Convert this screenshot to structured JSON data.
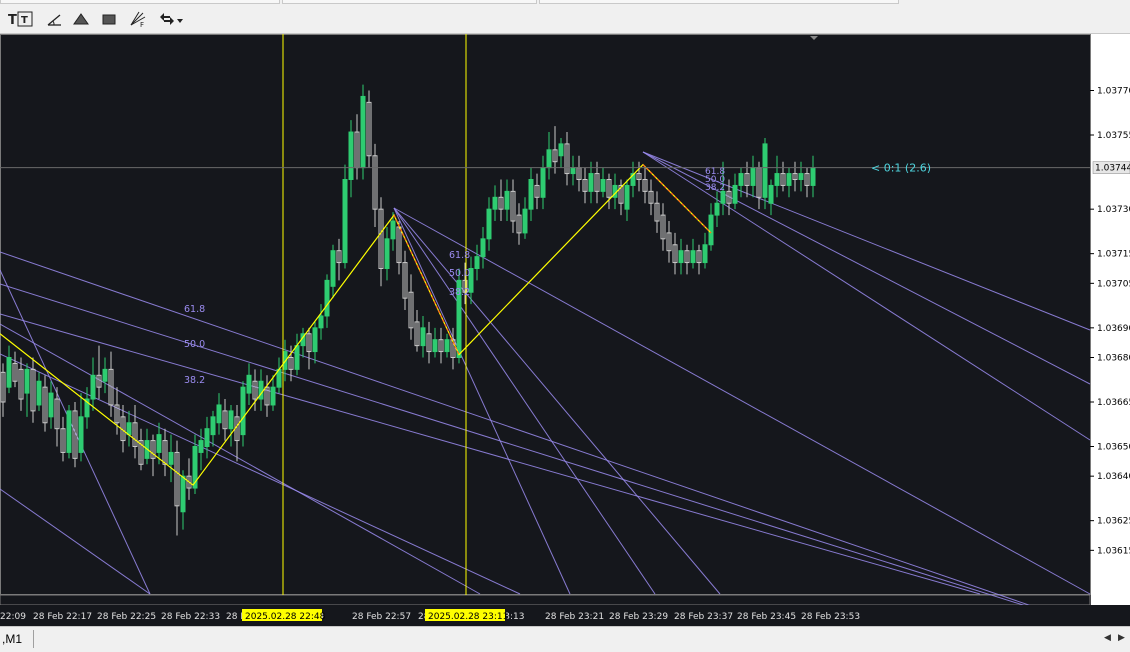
{
  "toolbar": {
    "tools": [
      {
        "icon": "text-label-icon",
        "glyph": "T"
      },
      {
        "icon": "text-frame-icon",
        "glyph": "T"
      },
      {
        "icon": "angle-draw-icon",
        "glyph": ""
      },
      {
        "icon": "triangle-icon",
        "glyph": ""
      },
      {
        "icon": "rectangle-icon",
        "glyph": ""
      },
      {
        "icon": "fibonacci-fan-icon",
        "glyph": "F"
      },
      {
        "icon": "arrows-menu-icon",
        "glyph": "▾"
      }
    ]
  },
  "colors": {
    "background": "#15171c",
    "grid_border": "#7a7a7a",
    "bull_candle": "#2ecc71",
    "bear_candle": "#c9c9c9",
    "zigzag": "#ffff00",
    "fan_lines": "#9b8cf0",
    "fan_labels": "#9b8cf0",
    "current_price_label": "#4fd6e0",
    "vertical_lines": "#ffff00",
    "date_badge_bg": "#ffff00"
  },
  "chart": {
    "price_levels": [
      "1.03770",
      "1.03755",
      "1.03730",
      "1.03715",
      "1.03705",
      "1.03690",
      "1.03680",
      "1.03665",
      "1.03650",
      "1.03640",
      "1.03625",
      "1.03615"
    ],
    "current_price": "1.03744",
    "fan_label_text": "< 0:1 (2.6)",
    "fan_level_labels": [
      "61.8",
      "50.0",
      "38.2"
    ],
    "time_labels": [
      "22:09",
      "28 Feb 22:17",
      "28 Feb 22:25",
      "28 Feb 22:33",
      "28 F",
      "22:49",
      "28 Feb 22:57",
      "28",
      "b 23:13",
      "28 Feb 23:21",
      "28 Feb 23:29",
      "28 Feb 23:37",
      "28 Feb 23:45",
      "28 Feb 23:53"
    ],
    "vline_badges": [
      "2025.02.28 22:48",
      "2025.02.28 23:11"
    ]
  },
  "chart_data": {
    "type": "candlestick",
    "title": "",
    "y_range": [
      1.03605,
      1.03785
    ],
    "current_price": 1.03744,
    "vertical_lines": [
      "2025.02.28 22:48",
      "2025.02.28 23:11"
    ],
    "zigzag_pivots": [
      {
        "x": 0,
        "y": 1.03688
      },
      {
        "x": 193,
        "y": 1.03637
      },
      {
        "x": 394,
        "y": 1.03728
      },
      {
        "x": 459,
        "y": 1.03681
      },
      {
        "x": 643,
        "y": 1.03745
      },
      {
        "x": 711,
        "y": 1.03722
      }
    ],
    "candles": [
      {
        "x": 3,
        "o": 1.03675,
        "c": 1.03665,
        "h": 1.03678,
        "l": 1.0366
      },
      {
        "x": 9,
        "o": 1.0367,
        "c": 1.0368,
        "h": 1.03684,
        "l": 1.03668
      },
      {
        "x": 15,
        "o": 1.03678,
        "c": 1.03672,
        "h": 1.03682,
        "l": 1.0367
      },
      {
        "x": 21,
        "o": 1.03676,
        "c": 1.03666,
        "h": 1.0368,
        "l": 1.03662
      },
      {
        "x": 27,
        "o": 1.03668,
        "c": 1.03676,
        "h": 1.03678,
        "l": 1.0366
      },
      {
        "x": 33,
        "o": 1.03676,
        "c": 1.03662,
        "h": 1.0368,
        "l": 1.03658
      },
      {
        "x": 39,
        "o": 1.03664,
        "c": 1.03672,
        "h": 1.03675,
        "l": 1.03662
      },
      {
        "x": 45,
        "o": 1.0367,
        "c": 1.03658,
        "h": 1.03674,
        "l": 1.03655
      },
      {
        "x": 51,
        "o": 1.0366,
        "c": 1.03668,
        "h": 1.03672,
        "l": 1.03656
      },
      {
        "x": 57,
        "o": 1.03666,
        "c": 1.03656,
        "h": 1.0367,
        "l": 1.0365
      },
      {
        "x": 63,
        "o": 1.03656,
        "c": 1.03648,
        "h": 1.0366,
        "l": 1.03645
      },
      {
        "x": 69,
        "o": 1.03648,
        "c": 1.03662,
        "h": 1.03664,
        "l": 1.03646
      },
      {
        "x": 75,
        "o": 1.03662,
        "c": 1.03646,
        "h": 1.03665,
        "l": 1.03643
      },
      {
        "x": 81,
        "o": 1.03648,
        "c": 1.0366,
        "h": 1.03668,
        "l": 1.03645
      },
      {
        "x": 87,
        "o": 1.0366,
        "c": 1.03666,
        "h": 1.0367,
        "l": 1.03656
      },
      {
        "x": 93,
        "o": 1.03666,
        "c": 1.03674,
        "h": 1.0368,
        "l": 1.03662
      },
      {
        "x": 99,
        "o": 1.03674,
        "c": 1.0367,
        "h": 1.03684,
        "l": 1.03666
      },
      {
        "x": 105,
        "o": 1.03672,
        "c": 1.03676,
        "h": 1.0368,
        "l": 1.03668
      },
      {
        "x": 111,
        "o": 1.03676,
        "c": 1.03664,
        "h": 1.03682,
        "l": 1.0366
      },
      {
        "x": 117,
        "o": 1.03664,
        "c": 1.03658,
        "h": 1.0367,
        "l": 1.03654
      },
      {
        "x": 123,
        "o": 1.0366,
        "c": 1.03652,
        "h": 1.03664,
        "l": 1.03648
      },
      {
        "x": 129,
        "o": 1.03654,
        "c": 1.03658,
        "h": 1.03662,
        "l": 1.0365
      },
      {
        "x": 135,
        "o": 1.03658,
        "c": 1.0365,
        "h": 1.03664,
        "l": 1.03646
      },
      {
        "x": 141,
        "o": 1.03652,
        "c": 1.03644,
        "h": 1.03656,
        "l": 1.03642
      },
      {
        "x": 147,
        "o": 1.03646,
        "c": 1.03652,
        "h": 1.03656,
        "l": 1.03644
      },
      {
        "x": 153,
        "o": 1.03652,
        "c": 1.03646,
        "h": 1.03654,
        "l": 1.0364
      },
      {
        "x": 159,
        "o": 1.03648,
        "c": 1.03654,
        "h": 1.03658,
        "l": 1.03644
      },
      {
        "x": 165,
        "o": 1.03652,
        "c": 1.03644,
        "h": 1.03656,
        "l": 1.0364
      },
      {
        "x": 171,
        "o": 1.03644,
        "c": 1.03648,
        "h": 1.03654,
        "l": 1.03638
      },
      {
        "x": 177,
        "o": 1.03648,
        "c": 1.0363,
        "h": 1.03652,
        "l": 1.0362
      },
      {
        "x": 183,
        "o": 1.03628,
        "c": 1.0364,
        "h": 1.03642,
        "l": 1.03622
      },
      {
        "x": 189,
        "o": 1.0364,
        "c": 1.03636,
        "h": 1.03646,
        "l": 1.03632
      },
      {
        "x": 195,
        "o": 1.03636,
        "c": 1.0365,
        "h": 1.03654,
        "l": 1.03634
      },
      {
        "x": 201,
        "o": 1.03648,
        "c": 1.03652,
        "h": 1.03656,
        "l": 1.03642
      },
      {
        "x": 207,
        "o": 1.0365,
        "c": 1.03656,
        "h": 1.0366,
        "l": 1.03646
      },
      {
        "x": 213,
        "o": 1.03654,
        "c": 1.0366,
        "h": 1.03662,
        "l": 1.0365
      },
      {
        "x": 219,
        "o": 1.03658,
        "c": 1.03664,
        "h": 1.03668,
        "l": 1.03654
      },
      {
        "x": 225,
        "o": 1.03662,
        "c": 1.03656,
        "h": 1.03666,
        "l": 1.03652
      },
      {
        "x": 231,
        "o": 1.03656,
        "c": 1.03662,
        "h": 1.03664,
        "l": 1.0365
      },
      {
        "x": 237,
        "o": 1.0366,
        "c": 1.03652,
        "h": 1.03664,
        "l": 1.03645
      },
      {
        "x": 243,
        "o": 1.03654,
        "c": 1.0367,
        "h": 1.03672,
        "l": 1.0365
      },
      {
        "x": 249,
        "o": 1.03668,
        "c": 1.03674,
        "h": 1.03678,
        "l": 1.03664
      },
      {
        "x": 255,
        "o": 1.03672,
        "c": 1.03666,
        "h": 1.03676,
        "l": 1.03662
      },
      {
        "x": 261,
        "o": 1.03666,
        "c": 1.03672,
        "h": 1.03676,
        "l": 1.03662
      },
      {
        "x": 267,
        "o": 1.0367,
        "c": 1.03664,
        "h": 1.03674,
        "l": 1.0366
      },
      {
        "x": 273,
        "o": 1.03664,
        "c": 1.0367,
        "h": 1.03674,
        "l": 1.03662
      },
      {
        "x": 279,
        "o": 1.0367,
        "c": 1.03676,
        "h": 1.0368,
        "l": 1.03668
      },
      {
        "x": 285,
        "o": 1.03676,
        "c": 1.03682,
        "h": 1.03686,
        "l": 1.03672
      },
      {
        "x": 291,
        "o": 1.0368,
        "c": 1.03676,
        "h": 1.03684,
        "l": 1.03672
      },
      {
        "x": 297,
        "o": 1.03676,
        "c": 1.03684,
        "h": 1.03688,
        "l": 1.03674
      },
      {
        "x": 303,
        "o": 1.03684,
        "c": 1.03688,
        "h": 1.0369,
        "l": 1.0368
      },
      {
        "x": 309,
        "o": 1.03688,
        "c": 1.03682,
        "h": 1.0369,
        "l": 1.03676
      },
      {
        "x": 315,
        "o": 1.03682,
        "c": 1.0369,
        "h": 1.03692,
        "l": 1.03678
      },
      {
        "x": 321,
        "o": 1.0369,
        "c": 1.03694,
        "h": 1.03698,
        "l": 1.03686
      },
      {
        "x": 327,
        "o": 1.03694,
        "c": 1.03706,
        "h": 1.03708,
        "l": 1.0369
      },
      {
        "x": 333,
        "o": 1.03704,
        "c": 1.03716,
        "h": 1.03718,
        "l": 1.037
      },
      {
        "x": 339,
        "o": 1.03716,
        "c": 1.03712,
        "h": 1.0372,
        "l": 1.03706
      },
      {
        "x": 345,
        "o": 1.03712,
        "c": 1.0374,
        "h": 1.03745,
        "l": 1.0371
      },
      {
        "x": 351,
        "o": 1.0374,
        "c": 1.03756,
        "h": 1.0376,
        "l": 1.03734
      },
      {
        "x": 357,
        "o": 1.03756,
        "c": 1.03744,
        "h": 1.03762,
        "l": 1.0374
      },
      {
        "x": 363,
        "o": 1.03744,
        "c": 1.03768,
        "h": 1.03772,
        "l": 1.0374
      },
      {
        "x": 369,
        "o": 1.03766,
        "c": 1.03748,
        "h": 1.0377,
        "l": 1.03744
      },
      {
        "x": 375,
        "o": 1.03748,
        "c": 1.0373,
        "h": 1.03752,
        "l": 1.03724
      },
      {
        "x": 381,
        "o": 1.0373,
        "c": 1.0371,
        "h": 1.03734,
        "l": 1.03704
      },
      {
        "x": 387,
        "o": 1.0371,
        "c": 1.0372,
        "h": 1.03724,
        "l": 1.03706
      },
      {
        "x": 393,
        "o": 1.0372,
        "c": 1.03726,
        "h": 1.03729,
        "l": 1.03716
      },
      {
        "x": 399,
        "o": 1.03724,
        "c": 1.03712,
        "h": 1.03726,
        "l": 1.03708
      },
      {
        "x": 405,
        "o": 1.03712,
        "c": 1.037,
        "h": 1.03716,
        "l": 1.03696
      },
      {
        "x": 411,
        "o": 1.03702,
        "c": 1.0369,
        "h": 1.03708,
        "l": 1.03686
      },
      {
        "x": 417,
        "o": 1.03692,
        "c": 1.03684,
        "h": 1.03696,
        "l": 1.03682
      },
      {
        "x": 423,
        "o": 1.03684,
        "c": 1.0369,
        "h": 1.03694,
        "l": 1.0368
      },
      {
        "x": 429,
        "o": 1.03688,
        "c": 1.03682,
        "h": 1.03692,
        "l": 1.03678
      },
      {
        "x": 435,
        "o": 1.03682,
        "c": 1.03686,
        "h": 1.0369,
        "l": 1.0368
      },
      {
        "x": 441,
        "o": 1.03686,
        "c": 1.03682,
        "h": 1.0369,
        "l": 1.03678
      },
      {
        "x": 447,
        "o": 1.03682,
        "c": 1.03686,
        "h": 1.03688,
        "l": 1.0368
      },
      {
        "x": 453,
        "o": 1.03686,
        "c": 1.0368,
        "h": 1.0369,
        "l": 1.03676
      },
      {
        "x": 459,
        "o": 1.0368,
        "c": 1.03706,
        "h": 1.0371,
        "l": 1.03678
      },
      {
        "x": 465,
        "o": 1.03706,
        "c": 1.03702,
        "h": 1.03712,
        "l": 1.03698
      },
      {
        "x": 471,
        "o": 1.03702,
        "c": 1.0371,
        "h": 1.03714,
        "l": 1.03698
      },
      {
        "x": 477,
        "o": 1.0371,
        "c": 1.03714,
        "h": 1.03718,
        "l": 1.03706
      },
      {
        "x": 483,
        "o": 1.03714,
        "c": 1.0372,
        "h": 1.03724,
        "l": 1.0371
      },
      {
        "x": 489,
        "o": 1.0372,
        "c": 1.0373,
        "h": 1.03734,
        "l": 1.03716
      },
      {
        "x": 495,
        "o": 1.0373,
        "c": 1.03734,
        "h": 1.03738,
        "l": 1.03726
      },
      {
        "x": 501,
        "o": 1.03734,
        "c": 1.0373,
        "h": 1.0374,
        "l": 1.03726
      },
      {
        "x": 507,
        "o": 1.0373,
        "c": 1.03736,
        "h": 1.0374,
        "l": 1.03726
      },
      {
        "x": 513,
        "o": 1.03736,
        "c": 1.03726,
        "h": 1.0374,
        "l": 1.03722
      },
      {
        "x": 519,
        "o": 1.03728,
        "c": 1.03722,
        "h": 1.03732,
        "l": 1.03718
      },
      {
        "x": 525,
        "o": 1.03722,
        "c": 1.0373,
        "h": 1.03734,
        "l": 1.0372
      },
      {
        "x": 531,
        "o": 1.0373,
        "c": 1.0374,
        "h": 1.03744,
        "l": 1.03726
      },
      {
        "x": 537,
        "o": 1.03738,
        "c": 1.03734,
        "h": 1.03742,
        "l": 1.0373
      },
      {
        "x": 543,
        "o": 1.03734,
        "c": 1.03744,
        "h": 1.03748,
        "l": 1.0373
      },
      {
        "x": 549,
        "o": 1.03744,
        "c": 1.0375,
        "h": 1.03756,
        "l": 1.0374
      },
      {
        "x": 555,
        "o": 1.0375,
        "c": 1.03746,
        "h": 1.03758,
        "l": 1.03742
      },
      {
        "x": 561,
        "o": 1.03748,
        "c": 1.03752,
        "h": 1.03754,
        "l": 1.03744
      },
      {
        "x": 567,
        "o": 1.03752,
        "c": 1.03742,
        "h": 1.03756,
        "l": 1.03738
      },
      {
        "x": 573,
        "o": 1.03742,
        "c": 1.03744,
        "h": 1.03748,
        "l": 1.03738
      },
      {
        "x": 579,
        "o": 1.03744,
        "c": 1.0374,
        "h": 1.03748,
        "l": 1.03736
      },
      {
        "x": 585,
        "o": 1.0374,
        "c": 1.03736,
        "h": 1.03744,
        "l": 1.03732
      },
      {
        "x": 591,
        "o": 1.03736,
        "c": 1.03742,
        "h": 1.03746,
        "l": 1.03732
      },
      {
        "x": 597,
        "o": 1.03742,
        "c": 1.03736,
        "h": 1.03746,
        "l": 1.03732
      },
      {
        "x": 603,
        "o": 1.03736,
        "c": 1.0374,
        "h": 1.03744,
        "l": 1.03734
      },
      {
        "x": 609,
        "o": 1.0374,
        "c": 1.03734,
        "h": 1.03742,
        "l": 1.0373
      },
      {
        "x": 615,
        "o": 1.03734,
        "c": 1.03738,
        "h": 1.03742,
        "l": 1.0373
      },
      {
        "x": 621,
        "o": 1.03738,
        "c": 1.03732,
        "h": 1.0374,
        "l": 1.03728
      },
      {
        "x": 627,
        "o": 1.0373,
        "c": 1.03738,
        "h": 1.0374,
        "l": 1.03726
      },
      {
        "x": 633,
        "o": 1.03738,
        "c": 1.03742,
        "h": 1.03746,
        "l": 1.03734
      },
      {
        "x": 639,
        "o": 1.03742,
        "c": 1.0374,
        "h": 1.03746,
        "l": 1.03736
      },
      {
        "x": 645,
        "o": 1.0374,
        "c": 1.03736,
        "h": 1.03744,
        "l": 1.03732
      },
      {
        "x": 651,
        "o": 1.03736,
        "c": 1.03732,
        "h": 1.0374,
        "l": 1.03728
      },
      {
        "x": 657,
        "o": 1.03732,
        "c": 1.03726,
        "h": 1.03736,
        "l": 1.03722
      },
      {
        "x": 663,
        "o": 1.03728,
        "c": 1.0372,
        "h": 1.03732,
        "l": 1.03716
      },
      {
        "x": 669,
        "o": 1.03722,
        "c": 1.03716,
        "h": 1.03726,
        "l": 1.03712
      },
      {
        "x": 675,
        "o": 1.03718,
        "c": 1.03712,
        "h": 1.03722,
        "l": 1.03708
      },
      {
        "x": 681,
        "o": 1.03712,
        "c": 1.03716,
        "h": 1.0372,
        "l": 1.03708
      },
      {
        "x": 687,
        "o": 1.03716,
        "c": 1.03712,
        "h": 1.03718,
        "l": 1.03708
      },
      {
        "x": 693,
        "o": 1.03712,
        "c": 1.03716,
        "h": 1.0372,
        "l": 1.0371
      },
      {
        "x": 699,
        "o": 1.03716,
        "c": 1.03712,
        "h": 1.03718,
        "l": 1.03708
      },
      {
        "x": 705,
        "o": 1.03712,
        "c": 1.03718,
        "h": 1.03722,
        "l": 1.0371
      },
      {
        "x": 711,
        "o": 1.03718,
        "c": 1.03728,
        "h": 1.03732,
        "l": 1.03716
      },
      {
        "x": 717,
        "o": 1.03728,
        "c": 1.03732,
        "h": 1.03736,
        "l": 1.03724
      },
      {
        "x": 723,
        "o": 1.03732,
        "c": 1.03736,
        "h": 1.03746,
        "l": 1.03728
      },
      {
        "x": 729,
        "o": 1.03736,
        "c": 1.03732,
        "h": 1.0374,
        "l": 1.03728
      },
      {
        "x": 735,
        "o": 1.03732,
        "c": 1.03738,
        "h": 1.03742,
        "l": 1.0373
      },
      {
        "x": 741,
        "o": 1.03738,
        "c": 1.03742,
        "h": 1.03744,
        "l": 1.03734
      },
      {
        "x": 747,
        "o": 1.03742,
        "c": 1.03738,
        "h": 1.03746,
        "l": 1.03734
      },
      {
        "x": 753,
        "o": 1.03738,
        "c": 1.03744,
        "h": 1.03748,
        "l": 1.03734
      },
      {
        "x": 759,
        "o": 1.03744,
        "c": 1.03734,
        "h": 1.03746,
        "l": 1.0373
      },
      {
        "x": 765,
        "o": 1.03734,
        "c": 1.03752,
        "h": 1.03754,
        "l": 1.0373
      },
      {
        "x": 771,
        "o": 1.03732,
        "c": 1.03738,
        "h": 1.0374,
        "l": 1.03728
      },
      {
        "x": 777,
        "o": 1.03738,
        "c": 1.03742,
        "h": 1.03748,
        "l": 1.03734
      },
      {
        "x": 783,
        "o": 1.03742,
        "c": 1.03738,
        "h": 1.03746,
        "l": 1.03736
      },
      {
        "x": 789,
        "o": 1.03738,
        "c": 1.03742,
        "h": 1.03744,
        "l": 1.03734
      },
      {
        "x": 795,
        "o": 1.03742,
        "c": 1.0374,
        "h": 1.03746,
        "l": 1.03736
      },
      {
        "x": 801,
        "o": 1.0374,
        "c": 1.03742,
        "h": 1.03746,
        "l": 1.03736
      },
      {
        "x": 807,
        "o": 1.03742,
        "c": 1.03738,
        "h": 1.03744,
        "l": 1.03734
      },
      {
        "x": 813,
        "o": 1.03738,
        "c": 1.03744,
        "h": 1.03748,
        "l": 1.03734
      }
    ]
  },
  "status": {
    "tab_label": ",M1"
  }
}
